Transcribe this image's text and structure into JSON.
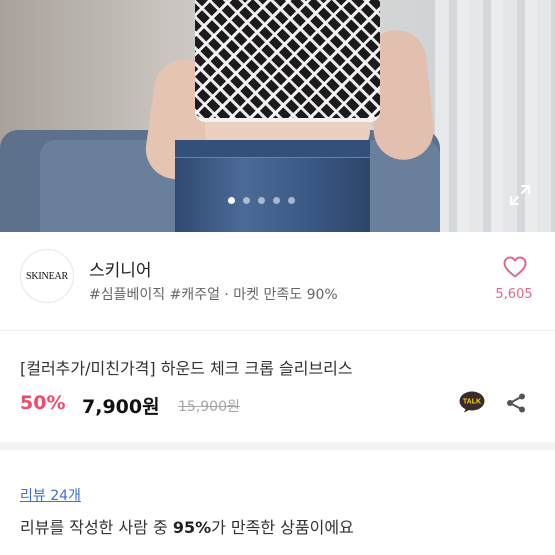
{
  "gallery": {
    "image_alt": "hero-product-photo",
    "page_count": 5,
    "active_index": 0
  },
  "seller": {
    "logo_text": "SKINEAR",
    "name": "스키니어",
    "tags": "#심플베이직 #캐주얼 · 마켓 만족도 90%",
    "like_count": "5,605"
  },
  "product": {
    "title": "[컬러추가/미친가격] 하운드 체크 크롭 슬리브리스",
    "discount": "50%",
    "price": "7,900원",
    "original_price": "15,900원"
  },
  "review": {
    "count_label": "리뷰 24개",
    "summary_prefix": "리뷰를 작성한 사람 중 ",
    "summary_percent": "95%",
    "summary_suffix": "가 만족한 상품이에요"
  },
  "icons": {
    "expand": "expand-icon",
    "heart": "heart-icon",
    "talk": "kakaotalk-icon",
    "share": "share-icon"
  },
  "colors": {
    "accent_pink": "#f04a6b",
    "heart": "#e06a86",
    "link_blue": "#3d6fd6"
  }
}
